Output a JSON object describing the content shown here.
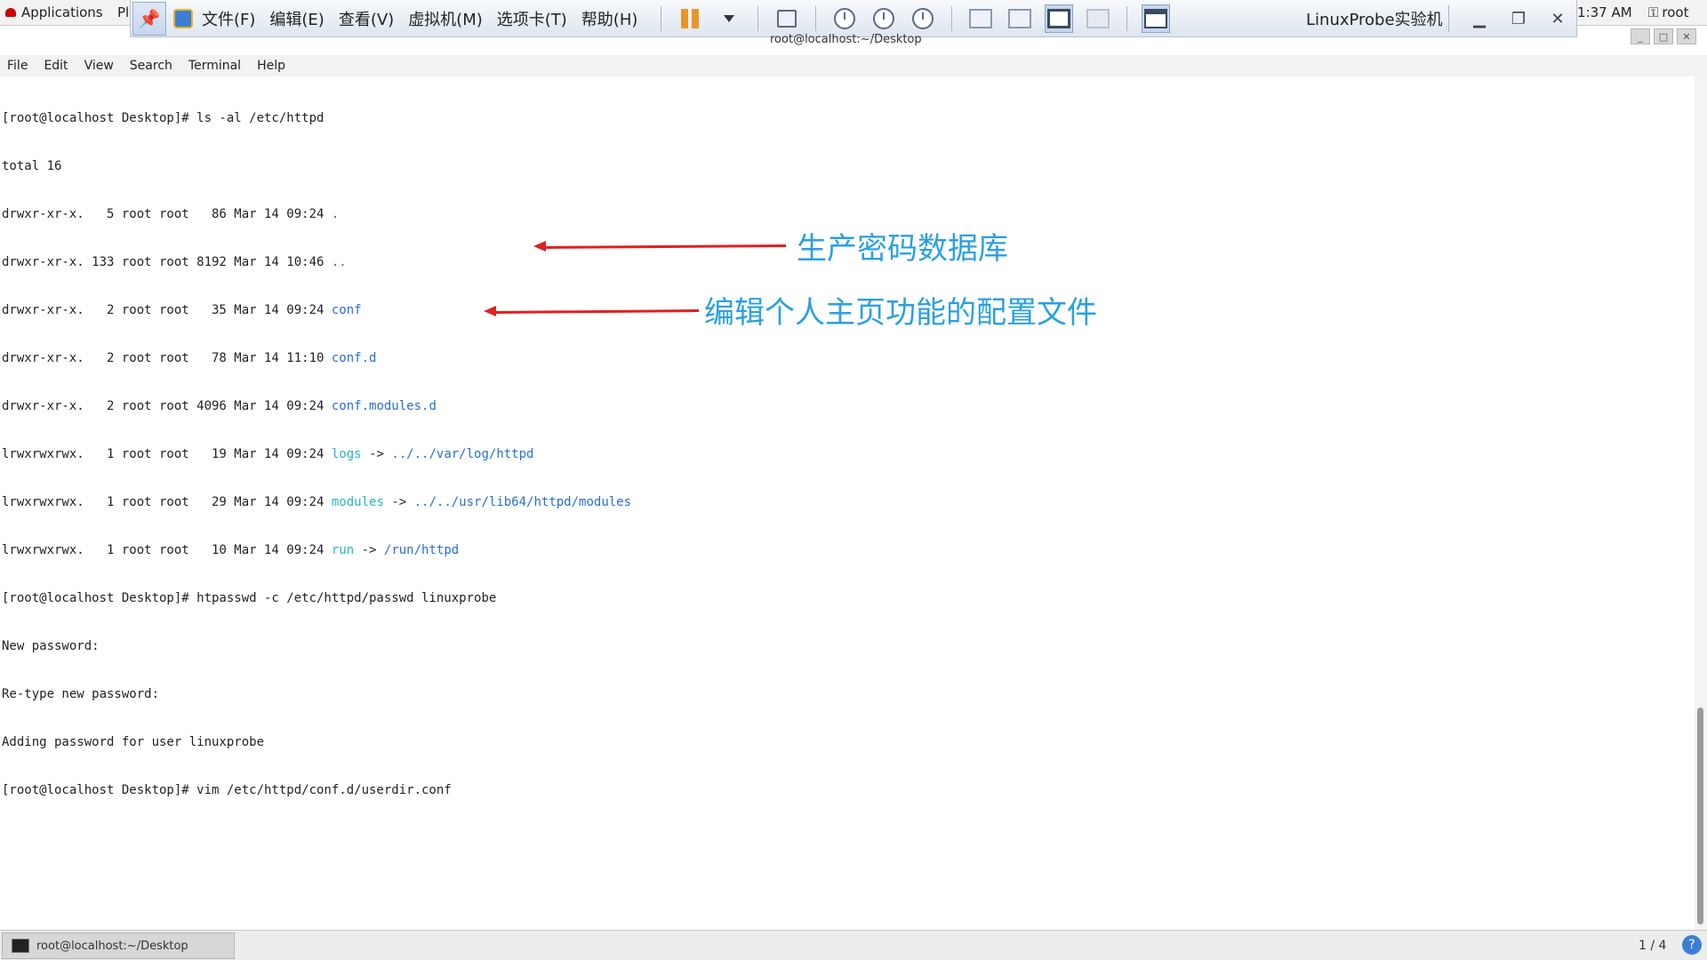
{
  "gnome_bar": {
    "applications": "Applications",
    "places": "Pl",
    "clock": "1:37 AM",
    "user": "root"
  },
  "vm_toolbar": {
    "menus": [
      "文件(F)",
      "编辑(E)",
      "查看(V)",
      "虚拟机(M)",
      "选项卡(T)",
      "帮助(H)"
    ],
    "vm_name": "LinuxProbe实验机"
  },
  "terminal": {
    "window_title": "root@localhost:~/Desktop",
    "menu": [
      "File",
      "Edit",
      "View",
      "Search",
      "Terminal",
      "Help"
    ],
    "lines": [
      {
        "text": "[root@localhost Desktop]# ls -al /etc/httpd"
      },
      {
        "text": "total 16"
      },
      {
        "text": "drwxr-xr-x.   5 root root   86 Mar 14 09:24 ",
        "name": ".",
        "kind": "dir"
      },
      {
        "text": "drwxr-xr-x. 133 root root 8192 Mar 14 10:46 ",
        "name": "..",
        "kind": "dir"
      },
      {
        "text": "drwxr-xr-x.   2 root root   35 Mar 14 09:24 ",
        "name": "conf",
        "kind": "dir"
      },
      {
        "text": "drwxr-xr-x.   2 root root   78 Mar 14 11:10 ",
        "name": "conf.d",
        "kind": "dir"
      },
      {
        "text": "drwxr-xr-x.   2 root root 4096 Mar 14 09:24 ",
        "name": "conf.modules.d",
        "kind": "dir"
      },
      {
        "text": "lrwxrwxrwx.   1 root root   19 Mar 14 09:24 ",
        "name": "logs",
        "kind": "link",
        "arrow": " -> ",
        "target": "../../var/log/httpd"
      },
      {
        "text": "lrwxrwxrwx.   1 root root   29 Mar 14 09:24 ",
        "name": "modules",
        "kind": "link",
        "arrow": " -> ",
        "target": "../../usr/lib64/httpd/modules"
      },
      {
        "text": "lrwxrwxrwx.   1 root root   10 Mar 14 09:24 ",
        "name": "run",
        "kind": "link",
        "arrow": " -> ",
        "target": "/run/httpd"
      },
      {
        "text": "[root@localhost Desktop]# htpasswd -c /etc/httpd/passwd linuxprobe"
      },
      {
        "text": "New password:"
      },
      {
        "text": "Re-type new password:"
      },
      {
        "text": "Adding password for user linuxprobe"
      },
      {
        "text": "[root@localhost Desktop]# vim /etc/httpd/conf.d/userdir.conf"
      }
    ]
  },
  "annotations": {
    "password_db": "生产密码数据库",
    "edit_userdir": "编辑个人主页功能的配置文件"
  },
  "taskbar": {
    "window": "root@localhost:~/Desktop",
    "workspace": "1 / 4",
    "help": "?"
  },
  "colors": {
    "dir": "#2a6fcf",
    "link": "#27b6c8",
    "annotation_text": "#2aa0e0",
    "annotation_arrow": "#e02020"
  }
}
